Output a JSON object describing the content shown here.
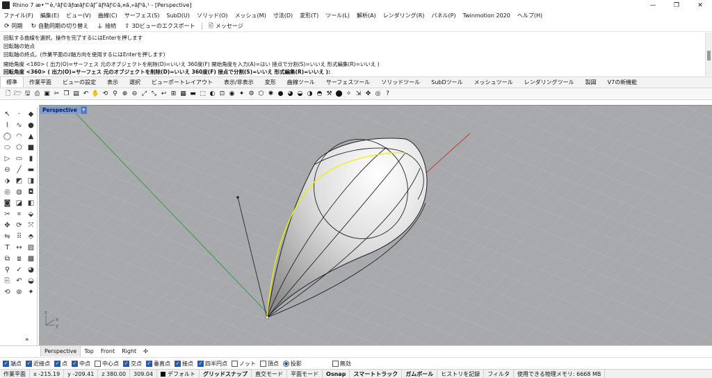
{
  "window": {
    "title": "Rhino 7 æ•™è‚²ãƒ©ãƒœãƒ©ãƒˆãƒªãƒ©ã‚¤ã‚»ãƒ³ã‚¹ - [Perspective]",
    "controls": [
      "—",
      "❐",
      "✕"
    ]
  },
  "menu": [
    "ファイル(F)",
    "編集(E)",
    "ビュー(V)",
    "曲線(C)",
    "サーフェス(S)",
    "SubD(U)",
    "ソリッド(O)",
    "メッシュ(M)",
    "寸法(D)",
    "変形(T)",
    "ツール(L)",
    "解析(A)",
    "レンダリング(R)",
    "パネル(P)",
    "Twinmotion 2020",
    "ヘルプ(H)"
  ],
  "commandbar": {
    "sync": "同期",
    "autosync": "自動同期の切り替え",
    "connect": "接続",
    "export3d": "3Dビューのエクスポート",
    "message": "メッセージ"
  },
  "history": {
    "lines": [
      "回転する曲線を選択。操作を完了するにはEnterを押します",
      "回転軸の始点",
      "回転軸の終点。(作業平面のz軸方向を使用するにはEnterを押します)",
      "開始角度 <180> ( 出力(O)=サーフェス  元のオブジェクトを削除(D)=いいえ  360度(F)  開始角度を入力(A)=はい  接点で分割(S)=いいえ  形式編集(R)=いいえ )"
    ],
    "current": "回転角度 <360> ( 出力(O)=サーフェス  元のオブジェクトを削除(D)=いいえ  360度(F)  接点で分割(S)=いいえ  形式編集(R)=いいえ ):"
  },
  "tabs": [
    "標準",
    "作業平面",
    "ビューの設定",
    "表示",
    "選択",
    "ビューポートレイアウト",
    "表示/非表示",
    "変形",
    "曲線ツール",
    "サーフェスツール",
    "ソリッドツール",
    "SubDツール",
    "メッシュツール",
    "レンダリングツール",
    "製図",
    "V7の新機能"
  ],
  "active_tab": "標準",
  "viewport": {
    "name": "Perspective",
    "axis_labels": {
      "x": "x",
      "y": "y",
      "z": "z"
    },
    "colors": {
      "background": "#a7a9ad",
      "grid": "#b6b8bc",
      "x_axis": "#c0392b",
      "y_axis": "#3c9a3c",
      "selected_curve": "#f0f000",
      "surface": "#d8d8d8"
    }
  },
  "viewtabs": [
    "Perspective",
    "Top",
    "Front",
    "Right",
    "✣"
  ],
  "active_viewtab": "Perspective",
  "osnap": [
    {
      "label": "端点",
      "checked": true
    },
    {
      "label": "近接点",
      "checked": true
    },
    {
      "label": "点",
      "checked": true
    },
    {
      "label": "中点",
      "checked": true
    },
    {
      "label": "中心点",
      "checked": false
    },
    {
      "label": "交点",
      "checked": true
    },
    {
      "label": "垂直点",
      "checked": true
    },
    {
      "label": "接点",
      "checked": true
    },
    {
      "label": "四半円点",
      "checked": true
    },
    {
      "label": "ノット",
      "checked": false
    },
    {
      "label": "頂点",
      "checked": false
    }
  ],
  "osnap_project": {
    "label": "投影",
    "checked": true
  },
  "osnap_disable": {
    "label": "無効",
    "checked": false
  },
  "status": {
    "plane": "作業平面",
    "x": "x -215.19",
    "y": "y -209.41",
    "z": "z 380.00",
    "distance": "309.04",
    "layer": "デフォルト",
    "gridsnap": "グリッドスナップ",
    "ortho": "直交モード",
    "planar": "平面モード",
    "osnap": "Osnap",
    "smarttrack": "スマートトラック",
    "gumball": "ガムボール",
    "history": "ヒストリを記録",
    "filter": "フィルタ",
    "memory": "使用できる物理メモリ: 6668 MB"
  }
}
